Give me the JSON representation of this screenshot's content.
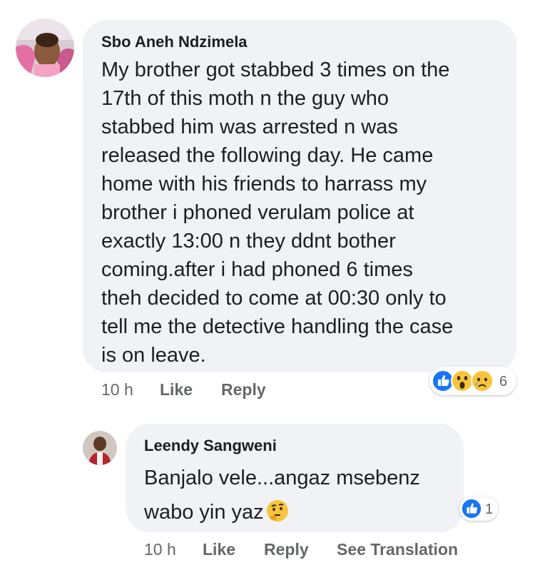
{
  "comments": [
    {
      "author": "Sbo Aneh Ndzimela",
      "lines": [
        "My brother got stabbed 3 times on the",
        "17th of this moth n the guy who",
        "stabbed him was arrested n was",
        "released the following day. He came",
        "home with his friends to harrass my",
        "brother i phoned verulam police at",
        "exactly 13:00 n they ddnt bother",
        "coming.after i had phoned 6 times",
        "theh decided to come at 00:30 only to",
        "tell me the detective handling the case",
        "is on leave."
      ],
      "time": "10 h",
      "like_label": "Like",
      "reply_label": "Reply",
      "reactions": [
        "like-icon",
        "wow-icon",
        "sad-icon"
      ],
      "reaction_count": "6"
    },
    {
      "author": "Leendy Sangweni",
      "lines": [
        "Banjalo vele...angaz msebenz",
        "wabo yin yaz"
      ],
      "emoji": "thinking-face-icon",
      "time": "10 h",
      "like_label": "Like",
      "reply_label": "Reply",
      "translate_label": "See Translation",
      "reactions": [
        "like-icon"
      ],
      "reaction_count": "1"
    }
  ],
  "colors": {
    "bubble": "#f0f2f5",
    "like_blue": "#1877f2",
    "emoji_yellow": "#f7c43c",
    "secondary_text": "#65676b"
  }
}
